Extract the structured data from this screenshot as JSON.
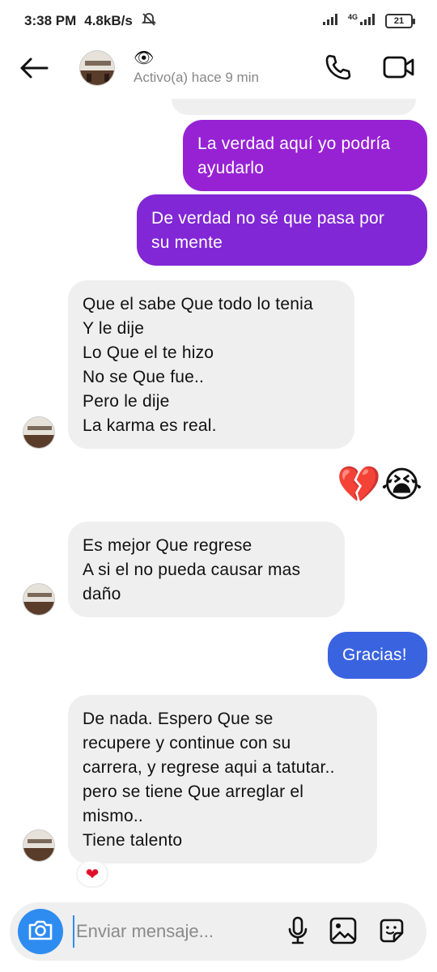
{
  "status_bar": {
    "time": "3:38 PM",
    "speed": "4.8kB/s",
    "network": "4G",
    "battery": "21"
  },
  "header": {
    "name_emoji": "👁",
    "status": "Activo(a) hace 9 min"
  },
  "messages": [
    {
      "from": "me",
      "lines": [
        "La verdad aquí yo podría",
        "ayudarlo"
      ]
    },
    {
      "from": "me",
      "lines": [
        "De verdad no sé que pasa por",
        "su mente"
      ]
    },
    {
      "from": "them",
      "lines": [
        "Que el sabe Que todo lo tenia",
        "Y le dije",
        "Lo Que el te hizo",
        "No se Que fue..",
        "Pero le dije",
        "La karma es real."
      ]
    },
    {
      "from": "me",
      "emoji": "💔😭"
    },
    {
      "from": "them",
      "lines": [
        "Es mejor Que regrese",
        "A si el no pueda causar mas",
        "daño"
      ]
    },
    {
      "from": "me",
      "lines": [
        "Gracias!"
      ]
    },
    {
      "from": "them",
      "lines": [
        "De nada. Espero Que se",
        "recupere y continue con su",
        "carrera, y regrese aqui a tatutar..",
        "pero se tiene Que arreglar el",
        "mismo..",
        "Tiene talento"
      ],
      "reaction": "❤"
    }
  ],
  "composer": {
    "placeholder": "Enviar mensaje..."
  },
  "colors": {
    "purple_top": "#9a22d6",
    "purple_mid": "#7d2ad6",
    "blue": "#3a63e0",
    "camera": "#2e8cf0",
    "incoming": "#efefef"
  },
  "icons": [
    "back-arrow-icon",
    "phone-icon",
    "video-camera-icon",
    "camera-icon",
    "microphone-icon",
    "gallery-icon",
    "sticker-icon",
    "heart-icon"
  ]
}
